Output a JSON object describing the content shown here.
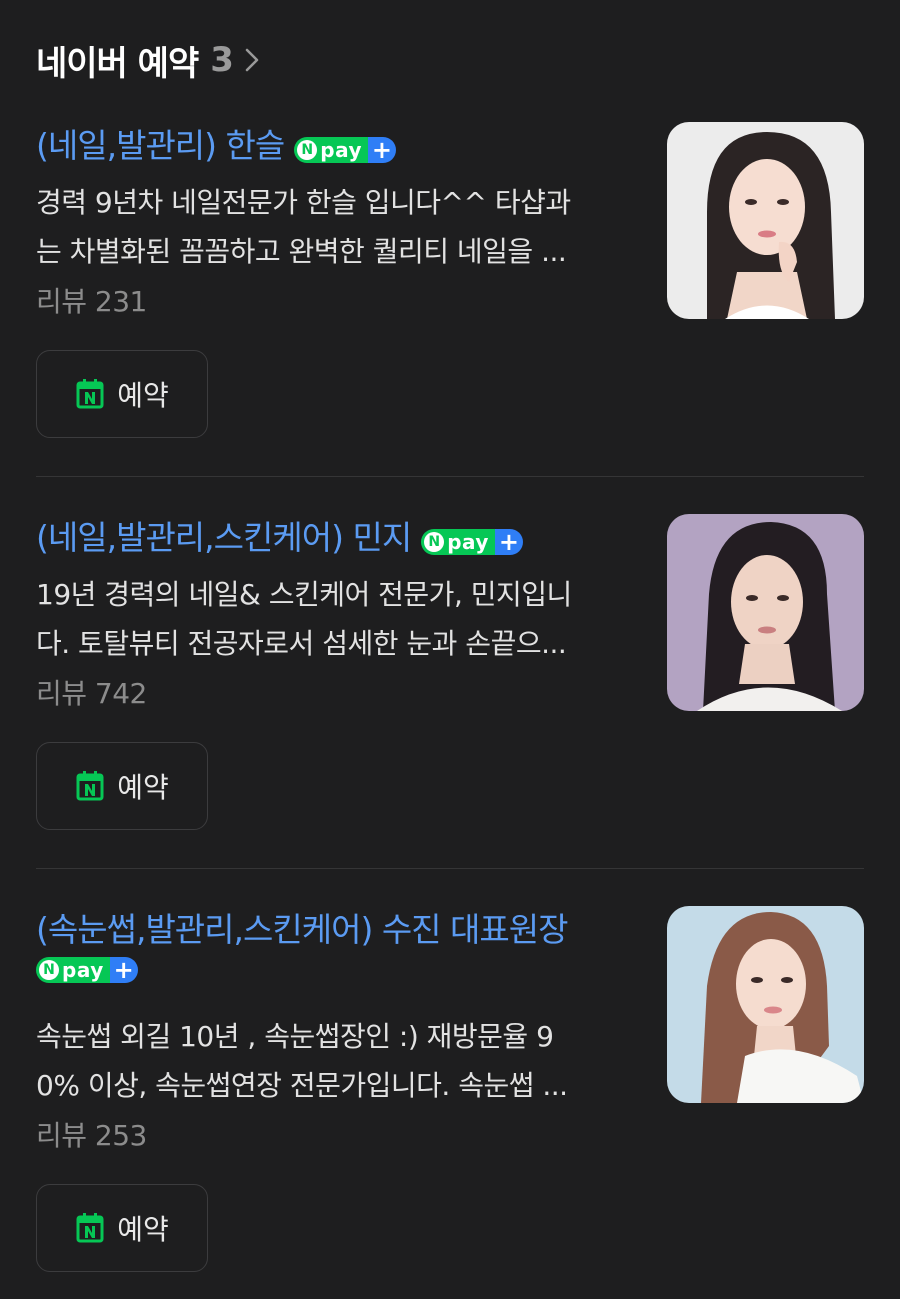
{
  "header": {
    "title": "네이버 예약",
    "count": "3",
    "chevron_icon": "chevron-right-icon"
  },
  "colors": {
    "background": "#1e1e1f",
    "link_blue": "#5b9bf2",
    "npay_green": "#06c755",
    "npay_blue": "#2f7ef6",
    "review_gray": "#8c8c8c"
  },
  "badge": {
    "n": "N",
    "pay": "pay",
    "plus": "+"
  },
  "listings": [
    {
      "title": "(네일,발관리) 한슬",
      "desc_lines": [
        "경력 9년차 네일전문가 한슬 입니다^^ 타샵과",
        "는 차별화된 꼼꼼하고 완벽한 퀄리티 네일을 ..."
      ],
      "review": "리뷰 231",
      "button_label": "예약",
      "button_icon": "naver-calendar-icon",
      "thumbnail": "woman-portrait-thumbnail"
    },
    {
      "title": "(네일,발관리,스킨케어) 민지",
      "desc_lines": [
        "19년 경력의 네일& 스킨케어 전문가, 민지입니",
        "다. 토탈뷰티 전공자로서 섬세한 눈과 손끝으..."
      ],
      "review": "리뷰 742",
      "button_label": "예약",
      "button_icon": "naver-calendar-icon",
      "thumbnail": "woman-portrait-thumbnail"
    },
    {
      "title": "(속눈썹,발관리,스킨케어) 수진 대표원장",
      "desc_lines": [
        "속눈썹 외길 10년 , 속눈썹장인 :) 재방문율 9",
        "0% 이상, 속눈썹연장 전문가입니다. 속눈썹 ..."
      ],
      "review": "리뷰 253",
      "button_label": "예약",
      "button_icon": "naver-calendar-icon",
      "thumbnail": "woman-portrait-thumbnail"
    }
  ]
}
